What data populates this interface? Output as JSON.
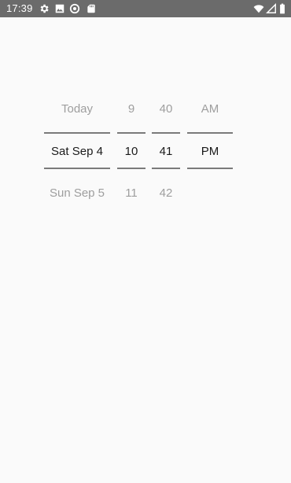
{
  "status_bar": {
    "time": "17:39",
    "left_icons": [
      "gear-icon",
      "image-icon",
      "sync-icon",
      "sd-card-icon"
    ],
    "right_icons": [
      "wifi-icon",
      "signal-icon",
      "battery-icon"
    ]
  },
  "picker": {
    "day_column": {
      "previous": "Today",
      "selected": "Sat Sep 4",
      "next": "Sun Sep 5"
    },
    "hour_column": {
      "previous": "9",
      "selected": "10",
      "next": "11"
    },
    "minute_column": {
      "previous": "40",
      "selected": "41",
      "next": "42"
    },
    "ampm_column": {
      "previous": "AM",
      "selected": "PM",
      "next": ""
    }
  },
  "colors": {
    "status_bar": "#6b6b6b",
    "background": "#fafafa",
    "selected_text": "#1a1a1a",
    "dim_text": "#9e9e9e",
    "divider": "#7a7a7a"
  }
}
